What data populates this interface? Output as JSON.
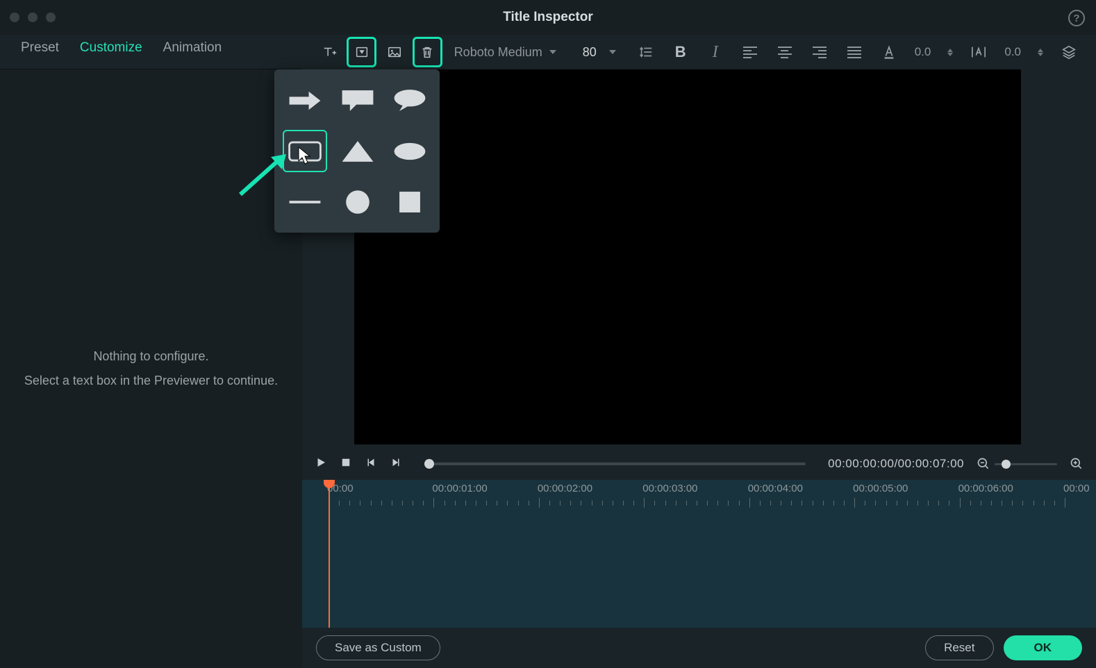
{
  "window": {
    "title": "Title Inspector"
  },
  "tabs": {
    "preset": "Preset",
    "customize": "Customize",
    "animation": "Animation",
    "active": "customize"
  },
  "toolbar": {
    "font": "Roboto Medium",
    "size": "80",
    "lineHeight": "0.0",
    "letterSpacing": "0.0"
  },
  "leftPanel": {
    "line1": "Nothing to configure.",
    "line2": "Select a text box in the Previewer to continue."
  },
  "shapes": {
    "items": [
      "arrow-right",
      "speech-bubble-rect",
      "speech-bubble-oval",
      "rounded-rect",
      "triangle",
      "ellipse",
      "line",
      "circle",
      "square"
    ],
    "selected": "rounded-rect"
  },
  "playback": {
    "timecode": "00:00:00:00/00:00:07:00"
  },
  "timeline": {
    "labels": [
      "00:00",
      "00:00:01:00",
      "00:00:02:00",
      "00:00:03:00",
      "00:00:04:00",
      "00:00:05:00",
      "00:00:06:00",
      "00:00"
    ]
  },
  "buttons": {
    "saveCustom": "Save as Custom",
    "reset": "Reset",
    "ok": "OK"
  },
  "accent": "#23dfa8"
}
